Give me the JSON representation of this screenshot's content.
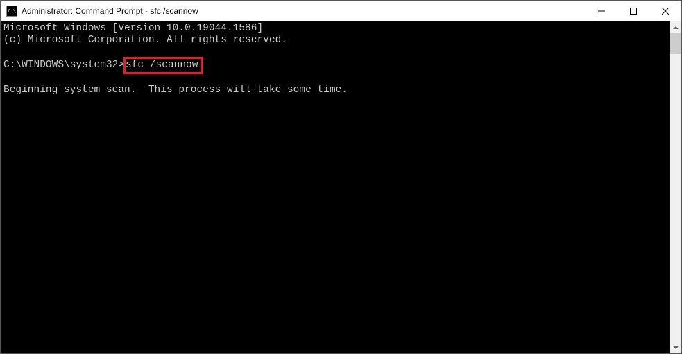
{
  "titlebar": {
    "icon_text": "C:\\",
    "title": "Administrator: Command Prompt - sfc  /scannow"
  },
  "window_controls": {
    "minimize": "minimize",
    "maximize": "maximize",
    "close": "close"
  },
  "console": {
    "line1": "Microsoft Windows [Version 10.0.19044.1586]",
    "line2": "(c) Microsoft Corporation. All rights reserved.",
    "blank1": "",
    "prompt": "C:\\WINDOWS\\system32>",
    "command": "sfc /scannow",
    "blank2": "",
    "status": "Beginning system scan.  This process will take some time."
  }
}
